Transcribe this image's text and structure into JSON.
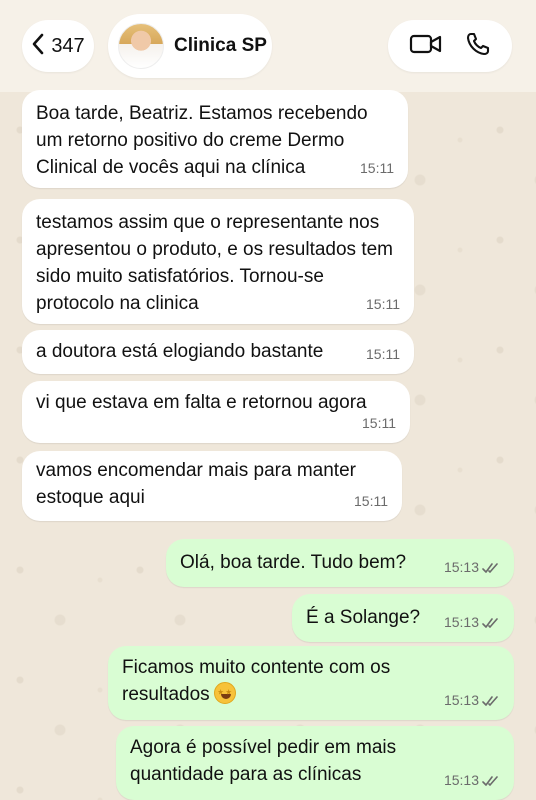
{
  "header": {
    "back_count": "347",
    "contact_name": "Clinica SP"
  },
  "messages": [
    {
      "direction": "incoming",
      "text": "Boa tarde, Beatriz. Estamos recebendo um retorno positivo do creme Dermo Clinical de vocês aqui na clínica",
      "time": "15:11"
    },
    {
      "direction": "incoming",
      "text": "testamos assim que o representante nos apresentou o produto, e os resultados tem sido muito satisfatórios. Tornou-se protocolo na clinica",
      "time": "15:11"
    },
    {
      "direction": "incoming",
      "text": "a doutora está elogiando bastante",
      "time": "15:11"
    },
    {
      "direction": "incoming",
      "text": "vi que estava em falta e retornou agora",
      "time": "15:11"
    },
    {
      "direction": "incoming",
      "text": "vamos encomendar mais para manter estoque aqui",
      "time": "15:11"
    },
    {
      "direction": "outgoing",
      "text": "Olá, boa tarde. Tudo bem?",
      "time": "15:13"
    },
    {
      "direction": "outgoing",
      "text": "É a Solange?",
      "time": "15:13"
    },
    {
      "direction": "outgoing",
      "text": "Ficamos muito contente com os resultados",
      "emoji": "star-struck-emoji",
      "time": "15:13"
    },
    {
      "direction": "outgoing",
      "text": "Agora é possível pedir em mais quantidade para as clínicas",
      "time": "15:13"
    }
  ],
  "colors": {
    "incoming_bubble": "#ffffff",
    "outgoing_bubble": "#d9fdd3",
    "wallpaper": "#efe7da",
    "read_ticks": "#6b6b6b"
  },
  "icons": {
    "back": "chevron-left-icon",
    "video": "video-camera-icon",
    "call": "phone-icon",
    "read": "double-check-icon"
  }
}
